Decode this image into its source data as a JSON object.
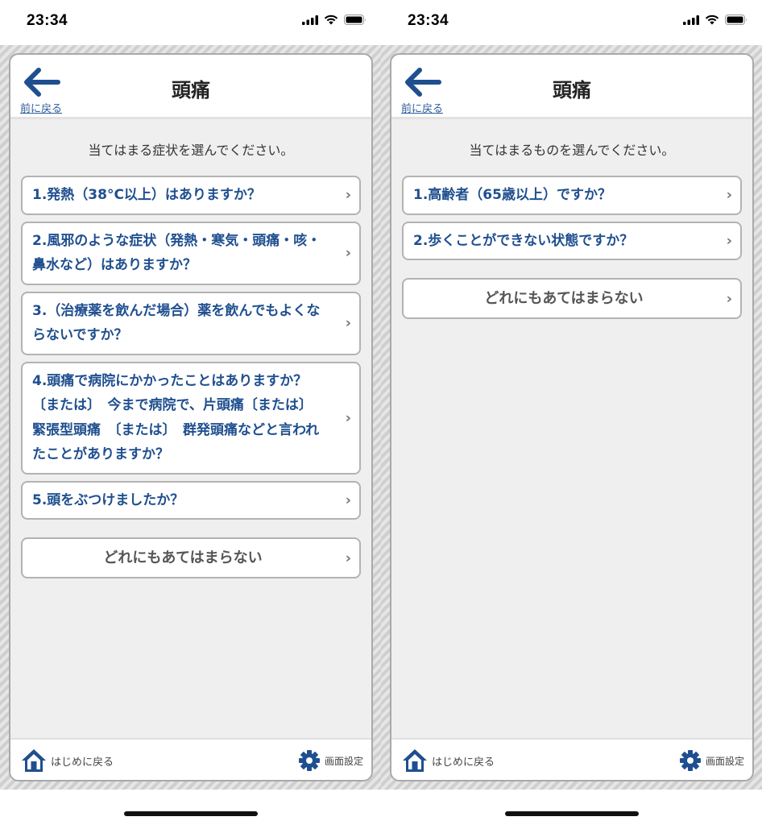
{
  "colors": {
    "accent": "#1f4f8f",
    "link": "#2c5c9c",
    "panel": "#efefef",
    "border": "#b3b3b3"
  },
  "screens": [
    {
      "status": {
        "time": "23:34"
      },
      "header": {
        "back_label": "前に戻る",
        "title": "頭痛"
      },
      "prompt": "当てはまる症状を選んでください。",
      "items": [
        {
          "label": "1.発熱（38°C以上）はありますか？"
        },
        {
          "label": "2.風邪のような症状（発熱・寒気・頭痛・咳・鼻水など）はありますか？"
        },
        {
          "label": "3.（治療薬を飲んだ場合）薬を飲んでもよくならないですか？"
        },
        {
          "label": "4.頭痛で病院にかかったことはありますか？　〔または〕　今まで病院で、片頭痛〔または〕　緊張型頭痛　〔または〕　群発頭痛などと言われたことがありますか？"
        },
        {
          "label": "5.頭をぶつけましたか？"
        }
      ],
      "none_label": "どれにもあてはまらない",
      "footer": {
        "home_label": "はじめに戻る",
        "settings_label": "画面設定"
      }
    },
    {
      "status": {
        "time": "23:34"
      },
      "header": {
        "back_label": "前に戻る",
        "title": "頭痛"
      },
      "prompt": "当てはまるものを選んでください。",
      "items": [
        {
          "label": "1.高齢者（65歳以上）ですか？"
        },
        {
          "label": "2.歩くことができない状態ですか？"
        }
      ],
      "none_label": "どれにもあてはまらない",
      "footer": {
        "home_label": "はじめに戻る",
        "settings_label": "画面設定"
      }
    }
  ]
}
